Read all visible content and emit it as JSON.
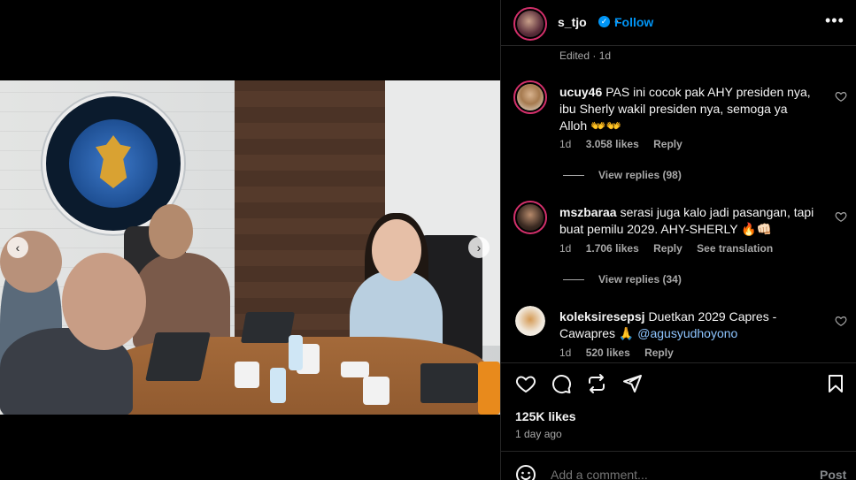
{
  "post": {
    "username": "s_tjo",
    "follow_label": "Follow",
    "separator": "•",
    "more_icon": "more-horizontal-icon",
    "edited": "Edited · 1d",
    "likes": "125K likes",
    "time_ago": "1 day ago"
  },
  "comments": [
    {
      "user": "ucuy46",
      "text": "PAS ini cocok pak AHY presiden nya, ibu Sherly wakil presiden nya, semoga ya Alloh 👐👐",
      "time": "1d",
      "likes": "3.058 likes",
      "reply": "Reply",
      "view_replies": "View replies (98)"
    },
    {
      "user": "mszbaraa",
      "text": "serasi juga kalo jadi pasangan, tapi buat pemilu 2029. AHY-SHERLY 🔥👊🏻",
      "time": "1d",
      "likes": "1.706 likes",
      "reply": "Reply",
      "see_translation": "See translation",
      "view_replies": "View replies (34)"
    },
    {
      "user": "koleksiresepsj",
      "text_before": "Duetkan 2029 Capres - Cawapres 🙏",
      "mention": "@agusyudhoyono",
      "time": "1d",
      "likes": "520 likes",
      "reply": "Reply"
    }
  ],
  "add_comment": {
    "placeholder": "Add a comment...",
    "post_label": "Post"
  },
  "icons": {
    "like": "heart-icon",
    "comment": "comment-icon",
    "share": "repost-icon",
    "send": "send-icon",
    "save": "bookmark-icon",
    "emoji": "emoji-icon"
  },
  "colors": {
    "accent": "#0095f6",
    "background": "#000000",
    "muted": "#a8a8a8"
  }
}
